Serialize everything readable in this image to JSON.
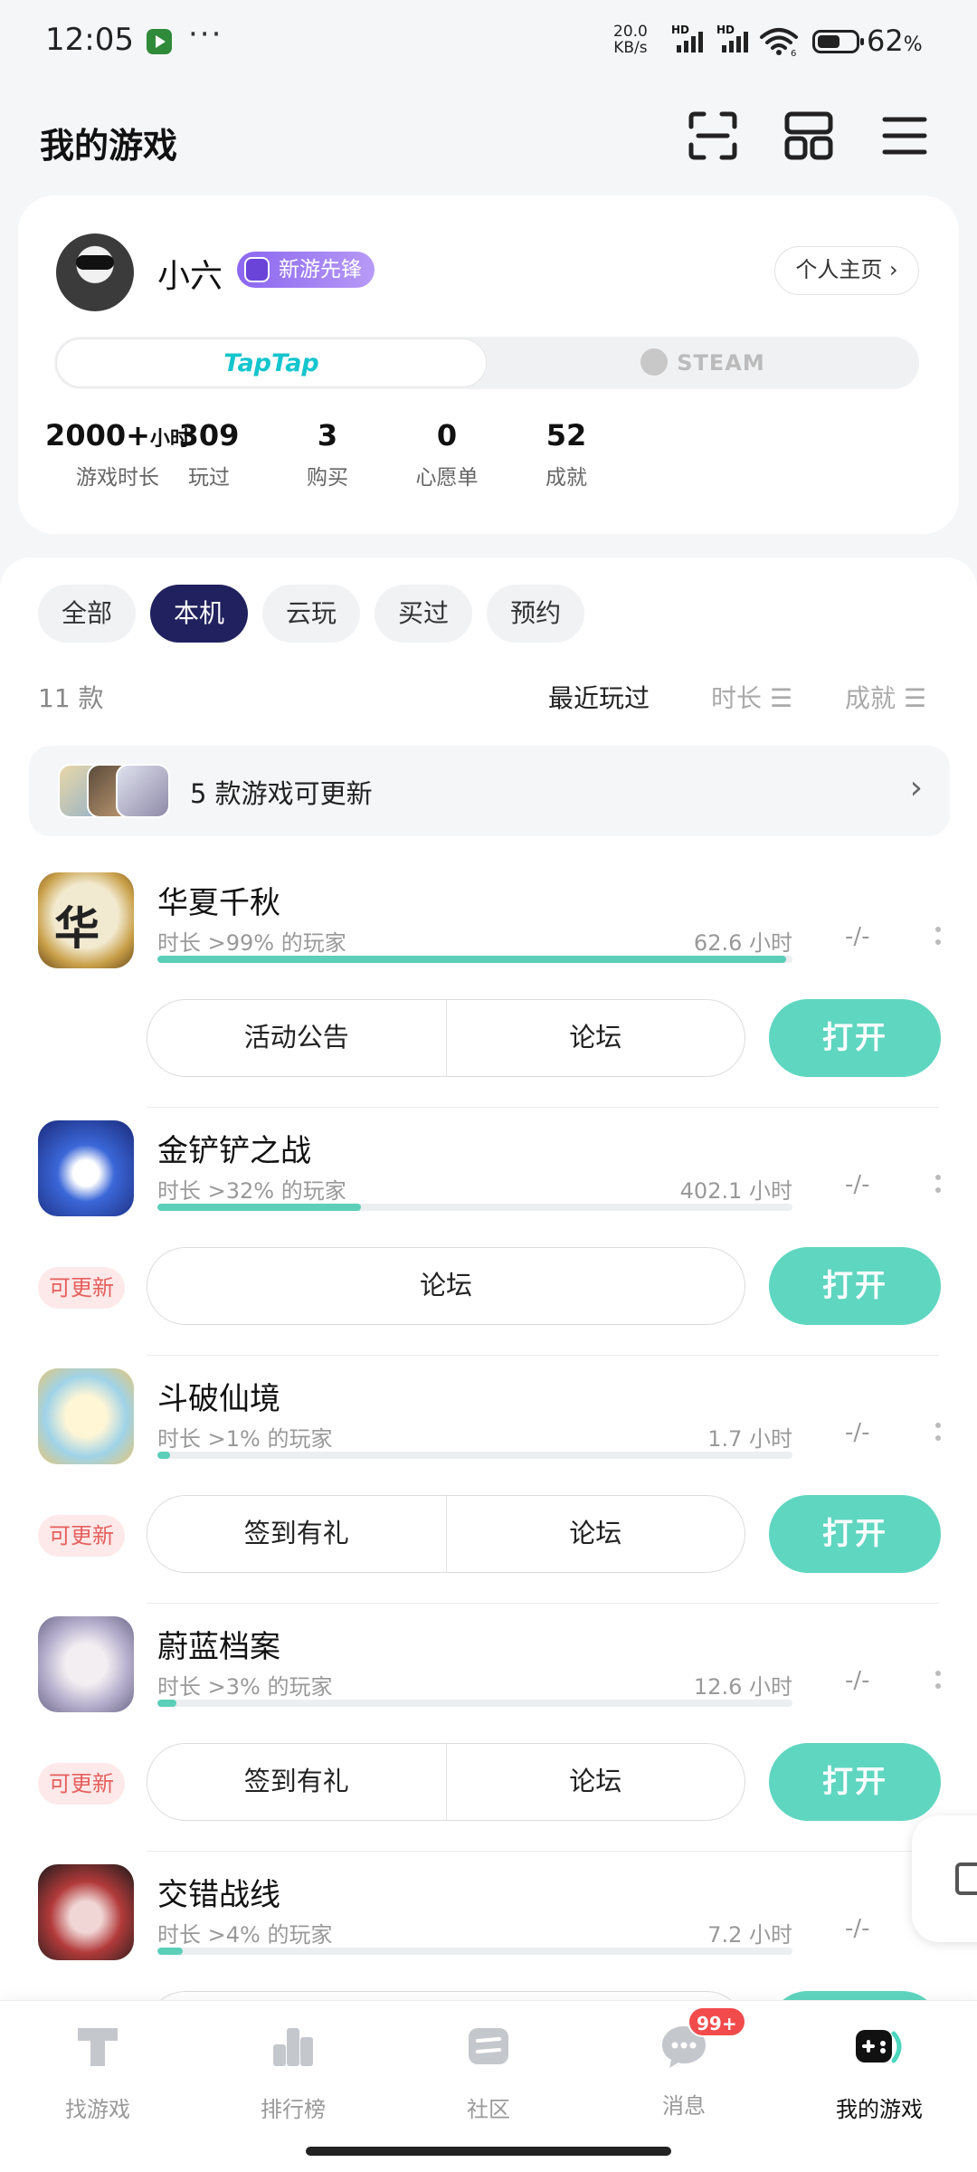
{
  "status_bar": {
    "time": "12:05",
    "more": "···",
    "net_speed": "20.0",
    "net_unit": "KB/s",
    "hd1": "HD",
    "hd2": "HD",
    "battery": "62",
    "battery_unit": "%",
    "wifi_sub": "6"
  },
  "header": {
    "title": "我的游戏",
    "icons": [
      "scan-icon",
      "grid-icon",
      "menu-icon"
    ]
  },
  "profile": {
    "name": "小六",
    "badge": "新游先锋",
    "home_button": "个人主页 ›",
    "platforms": [
      "TapTap",
      "STEAM"
    ],
    "stats": [
      {
        "value": "2000+",
        "unit": "小时",
        "label": "游戏时长"
      },
      {
        "value": "309",
        "unit": "",
        "label": "玩过"
      },
      {
        "value": "3",
        "unit": "",
        "label": "购买"
      },
      {
        "value": "0",
        "unit": "",
        "label": "心愿单"
      },
      {
        "value": "52",
        "unit": "",
        "label": "成就"
      }
    ]
  },
  "filters": {
    "chips": [
      "全部",
      "本机",
      "云玩",
      "买过",
      "预约"
    ],
    "active": "本机"
  },
  "list": {
    "count": "11 款",
    "sort": [
      "最近玩过",
      "时长 ☰",
      "成就 ☰"
    ],
    "update_notice": "5 款游戏可更新"
  },
  "games": [
    {
      "name": "华夏千秋",
      "pct_text": "时长 >99% 的玩家",
      "hours": "62.6 小时",
      "progress": 0.99,
      "rating": "-/-",
      "update": "",
      "actions": [
        "活动公告",
        "论坛"
      ],
      "open": "打开"
    },
    {
      "name": "金铲铲之战",
      "pct_text": "时长 >32% 的玩家",
      "hours": "402.1 小时",
      "progress": 0.32,
      "rating": "-/-",
      "update": "可更新",
      "actions": [
        "论坛"
      ],
      "open": "打开"
    },
    {
      "name": "斗破仙境",
      "pct_text": "时长 >1% 的玩家",
      "hours": "1.7 小时",
      "progress": 0.01,
      "rating": "-/-",
      "update": "可更新",
      "actions": [
        "签到有礼",
        "论坛"
      ],
      "open": "打开"
    },
    {
      "name": "蔚蓝档案",
      "pct_text": "时长 >3% 的玩家",
      "hours": "12.6 小时",
      "progress": 0.03,
      "rating": "-/-",
      "update": "可更新",
      "actions": [
        "签到有礼",
        "论坛"
      ],
      "open": "打开"
    },
    {
      "name": "交错战线",
      "pct_text": "时长 >4% 的玩家",
      "hours": "7.2 小时",
      "progress": 0.04,
      "rating": "-/-",
      "update": "",
      "actions": [],
      "open": ""
    }
  ],
  "bottom_nav": [
    {
      "label": "找游戏",
      "icon": "discover-icon"
    },
    {
      "label": "排行榜",
      "icon": "ranking-icon"
    },
    {
      "label": "社区",
      "icon": "community-icon"
    },
    {
      "label": "消息",
      "icon": "message-icon",
      "badge": "99+"
    },
    {
      "label": "我的游戏",
      "icon": "my-games-icon",
      "active": true
    }
  ],
  "colors": {
    "accent": "#5fd6c0",
    "active_chip": "#20215e",
    "update_badge": "#e4605e",
    "taptap": "#15c5ce",
    "badge_purple": "#8b66f0"
  }
}
